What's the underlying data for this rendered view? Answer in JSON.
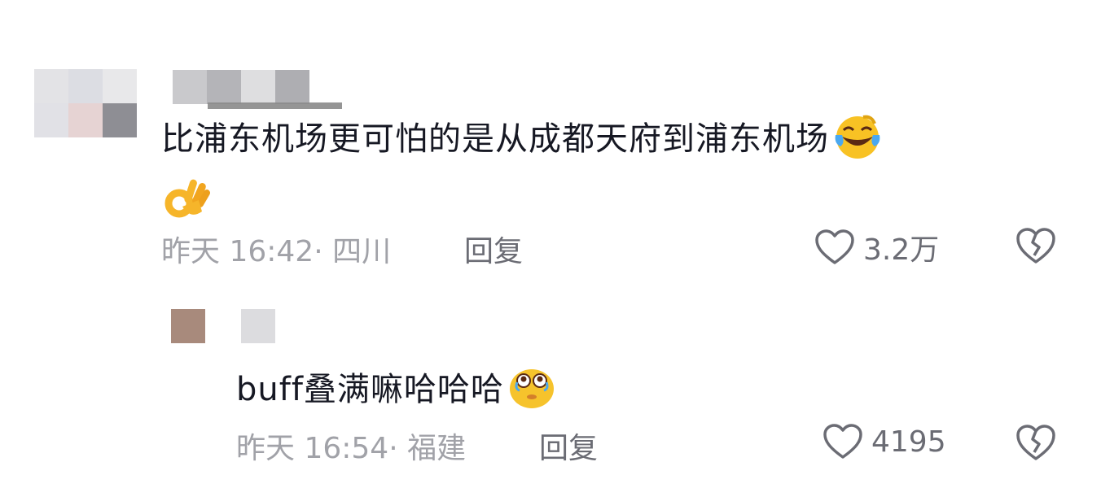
{
  "comments": [
    {
      "text": "比浦东机场更可怕的是从成都天府到浦东机场",
      "time_location": "昨天 16:42· 四川",
      "reply_label": "回复",
      "likes": "3.2万"
    },
    {
      "text": "buff叠满嘛哈哈哈",
      "time_location": "昨天 16:54· 福建",
      "reply_label": "回复",
      "likes": "4195"
    }
  ],
  "colors": {
    "text": "#161823",
    "meta": "#a1a2a8",
    "action": "#6b6c74"
  },
  "icons": [
    "laughing-tears-emoji-icon",
    "ok-hand-emoji-icon",
    "heart-icon",
    "broken-heart-icon",
    "tearful-face-emoji-icon"
  ]
}
